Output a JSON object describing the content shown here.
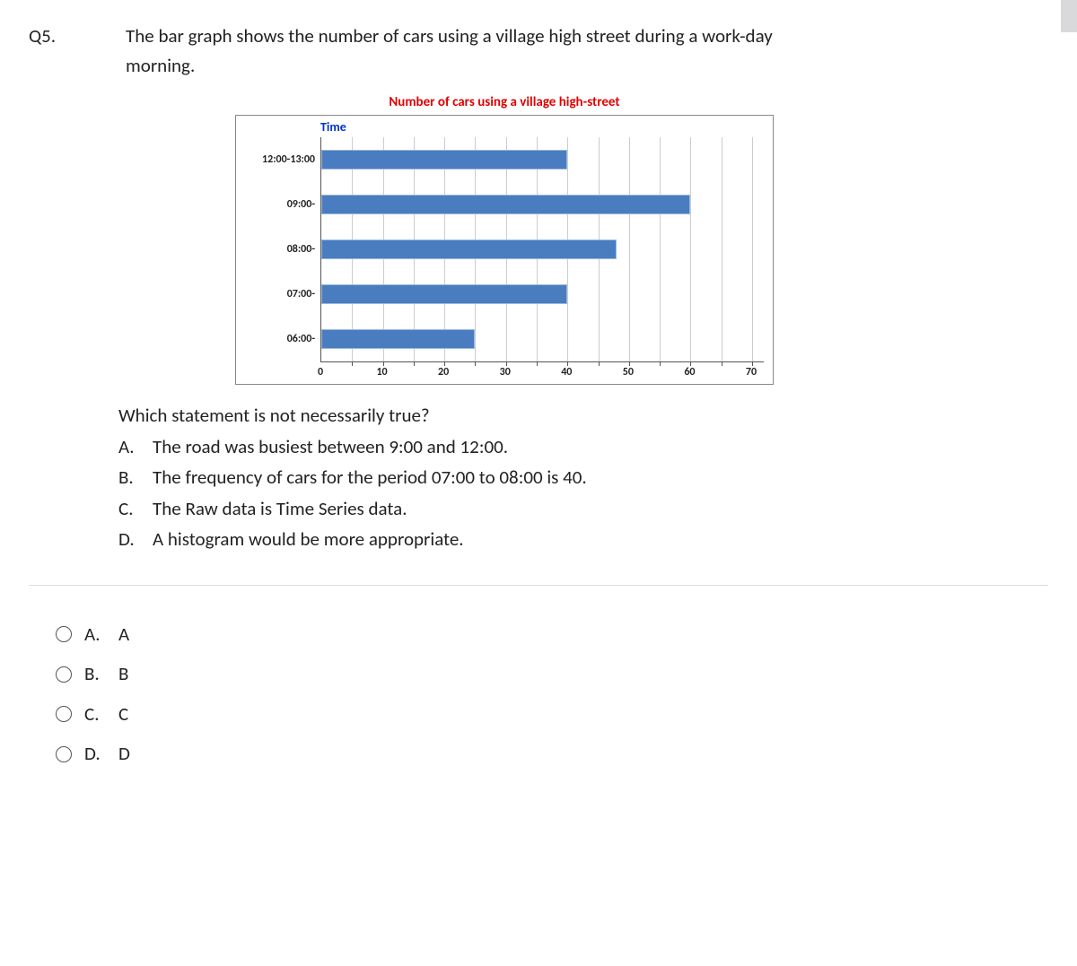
{
  "question": {
    "number": "Q5.",
    "prompt_line1": "The bar graph shows the number of cars using a village high street during a work-day",
    "prompt_line2": "morning."
  },
  "chart_data": {
    "type": "bar",
    "orientation": "horizontal",
    "title": "Number of cars using a village high-street",
    "ylabel": "Time",
    "xlabel": "",
    "categories": [
      "12:00-13:00",
      "09:00-",
      "08:00-",
      "07:00-",
      "06:00-"
    ],
    "values": [
      40,
      60,
      48,
      40,
      25
    ],
    "xlim": [
      0,
      70
    ],
    "xticks": [
      0,
      10,
      20,
      30,
      40,
      50,
      60,
      70
    ]
  },
  "sub_question": "Which statement is not necessarily true?",
  "statements": [
    {
      "letter": "A.",
      "text": "The road was busiest between 9:00 and 12:00."
    },
    {
      "letter": "B.",
      "text": "The frequency of cars for the period 07:00 to 08:00 is 40."
    },
    {
      "letter": "C.",
      "text": "The Raw data is Time Series data."
    },
    {
      "letter": "D.",
      "text": "A histogram would be more appropriate."
    }
  ],
  "answers": [
    {
      "letter": "A.",
      "value": "A"
    },
    {
      "letter": "B.",
      "value": "B"
    },
    {
      "letter": "C.",
      "value": "C"
    },
    {
      "letter": "D.",
      "value": "D"
    }
  ]
}
